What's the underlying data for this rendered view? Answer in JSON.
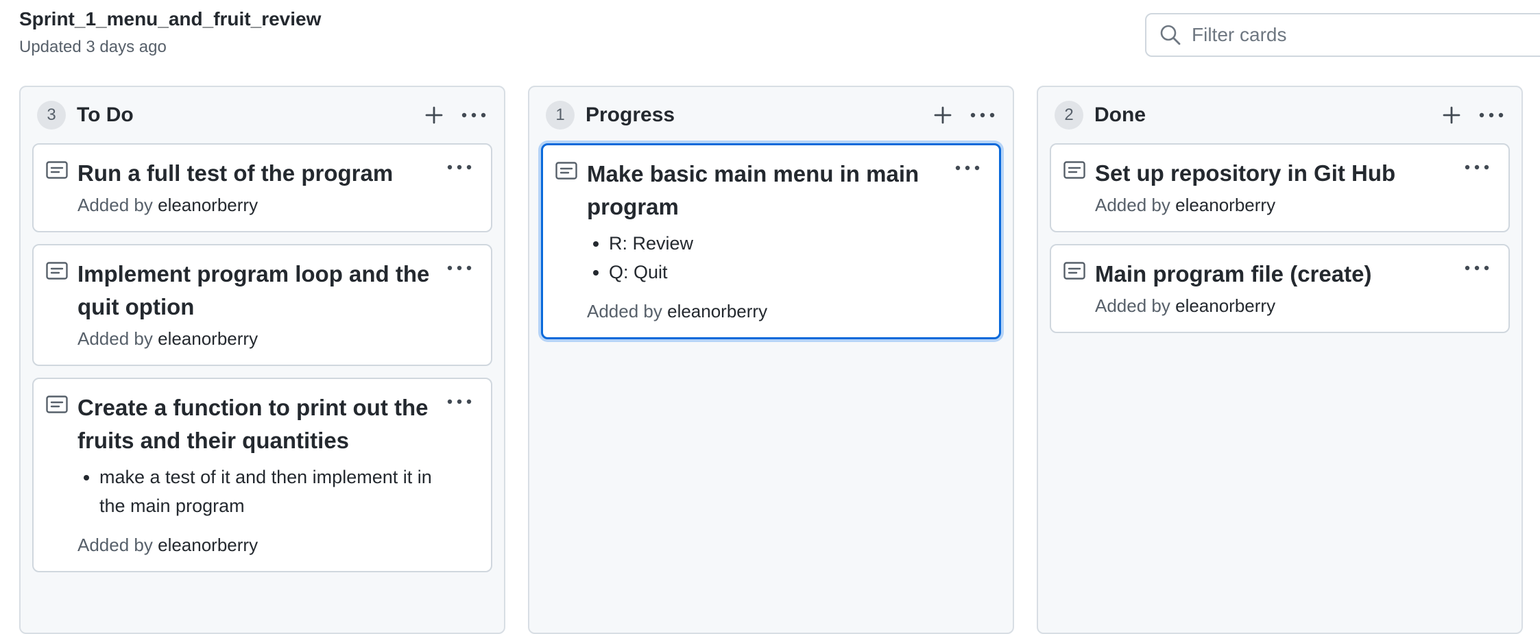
{
  "board": {
    "title": "Sprint_1_menu_and_fruit_review",
    "updated": "Updated 3 days ago"
  },
  "filter": {
    "placeholder": "Filter cards"
  },
  "columns": [
    {
      "count": "3",
      "title": "To Do",
      "cards": [
        {
          "title": "Run a full test of the program",
          "bullets": [],
          "added_prefix": "Added by",
          "author": "eleanorberry"
        },
        {
          "title": "Implement program loop and the quit option",
          "bullets": [],
          "added_prefix": "Added by",
          "author": "eleanorberry"
        },
        {
          "title": "Create a function to print out the fruits and their quantities",
          "bullets": [
            "make a test of it and then implement it in the main program"
          ],
          "added_prefix": "Added by",
          "author": "eleanorberry"
        }
      ]
    },
    {
      "count": "1",
      "title": "Progress",
      "cards": [
        {
          "title": "Make basic main menu in main program",
          "bullets": [
            "R: Review",
            "Q: Quit"
          ],
          "added_prefix": "Added by",
          "author": "eleanorberry",
          "selected": true
        }
      ]
    },
    {
      "count": "2",
      "title": "Done",
      "cards": [
        {
          "title": "Set up repository in Git Hub",
          "bullets": [],
          "added_prefix": "Added by",
          "author": "eleanorberry"
        },
        {
          "title": "Main program file (create)",
          "bullets": [],
          "added_prefix": "Added by",
          "author": "eleanorberry"
        }
      ]
    }
  ],
  "icons": {
    "search": "search-icon",
    "add": "plus-icon",
    "more": "kebab-horizontal-icon",
    "note": "note-icon"
  },
  "colors": {
    "accent": "#0969da",
    "column_bg": "#f6f8fa",
    "muted_text": "#57606a"
  }
}
